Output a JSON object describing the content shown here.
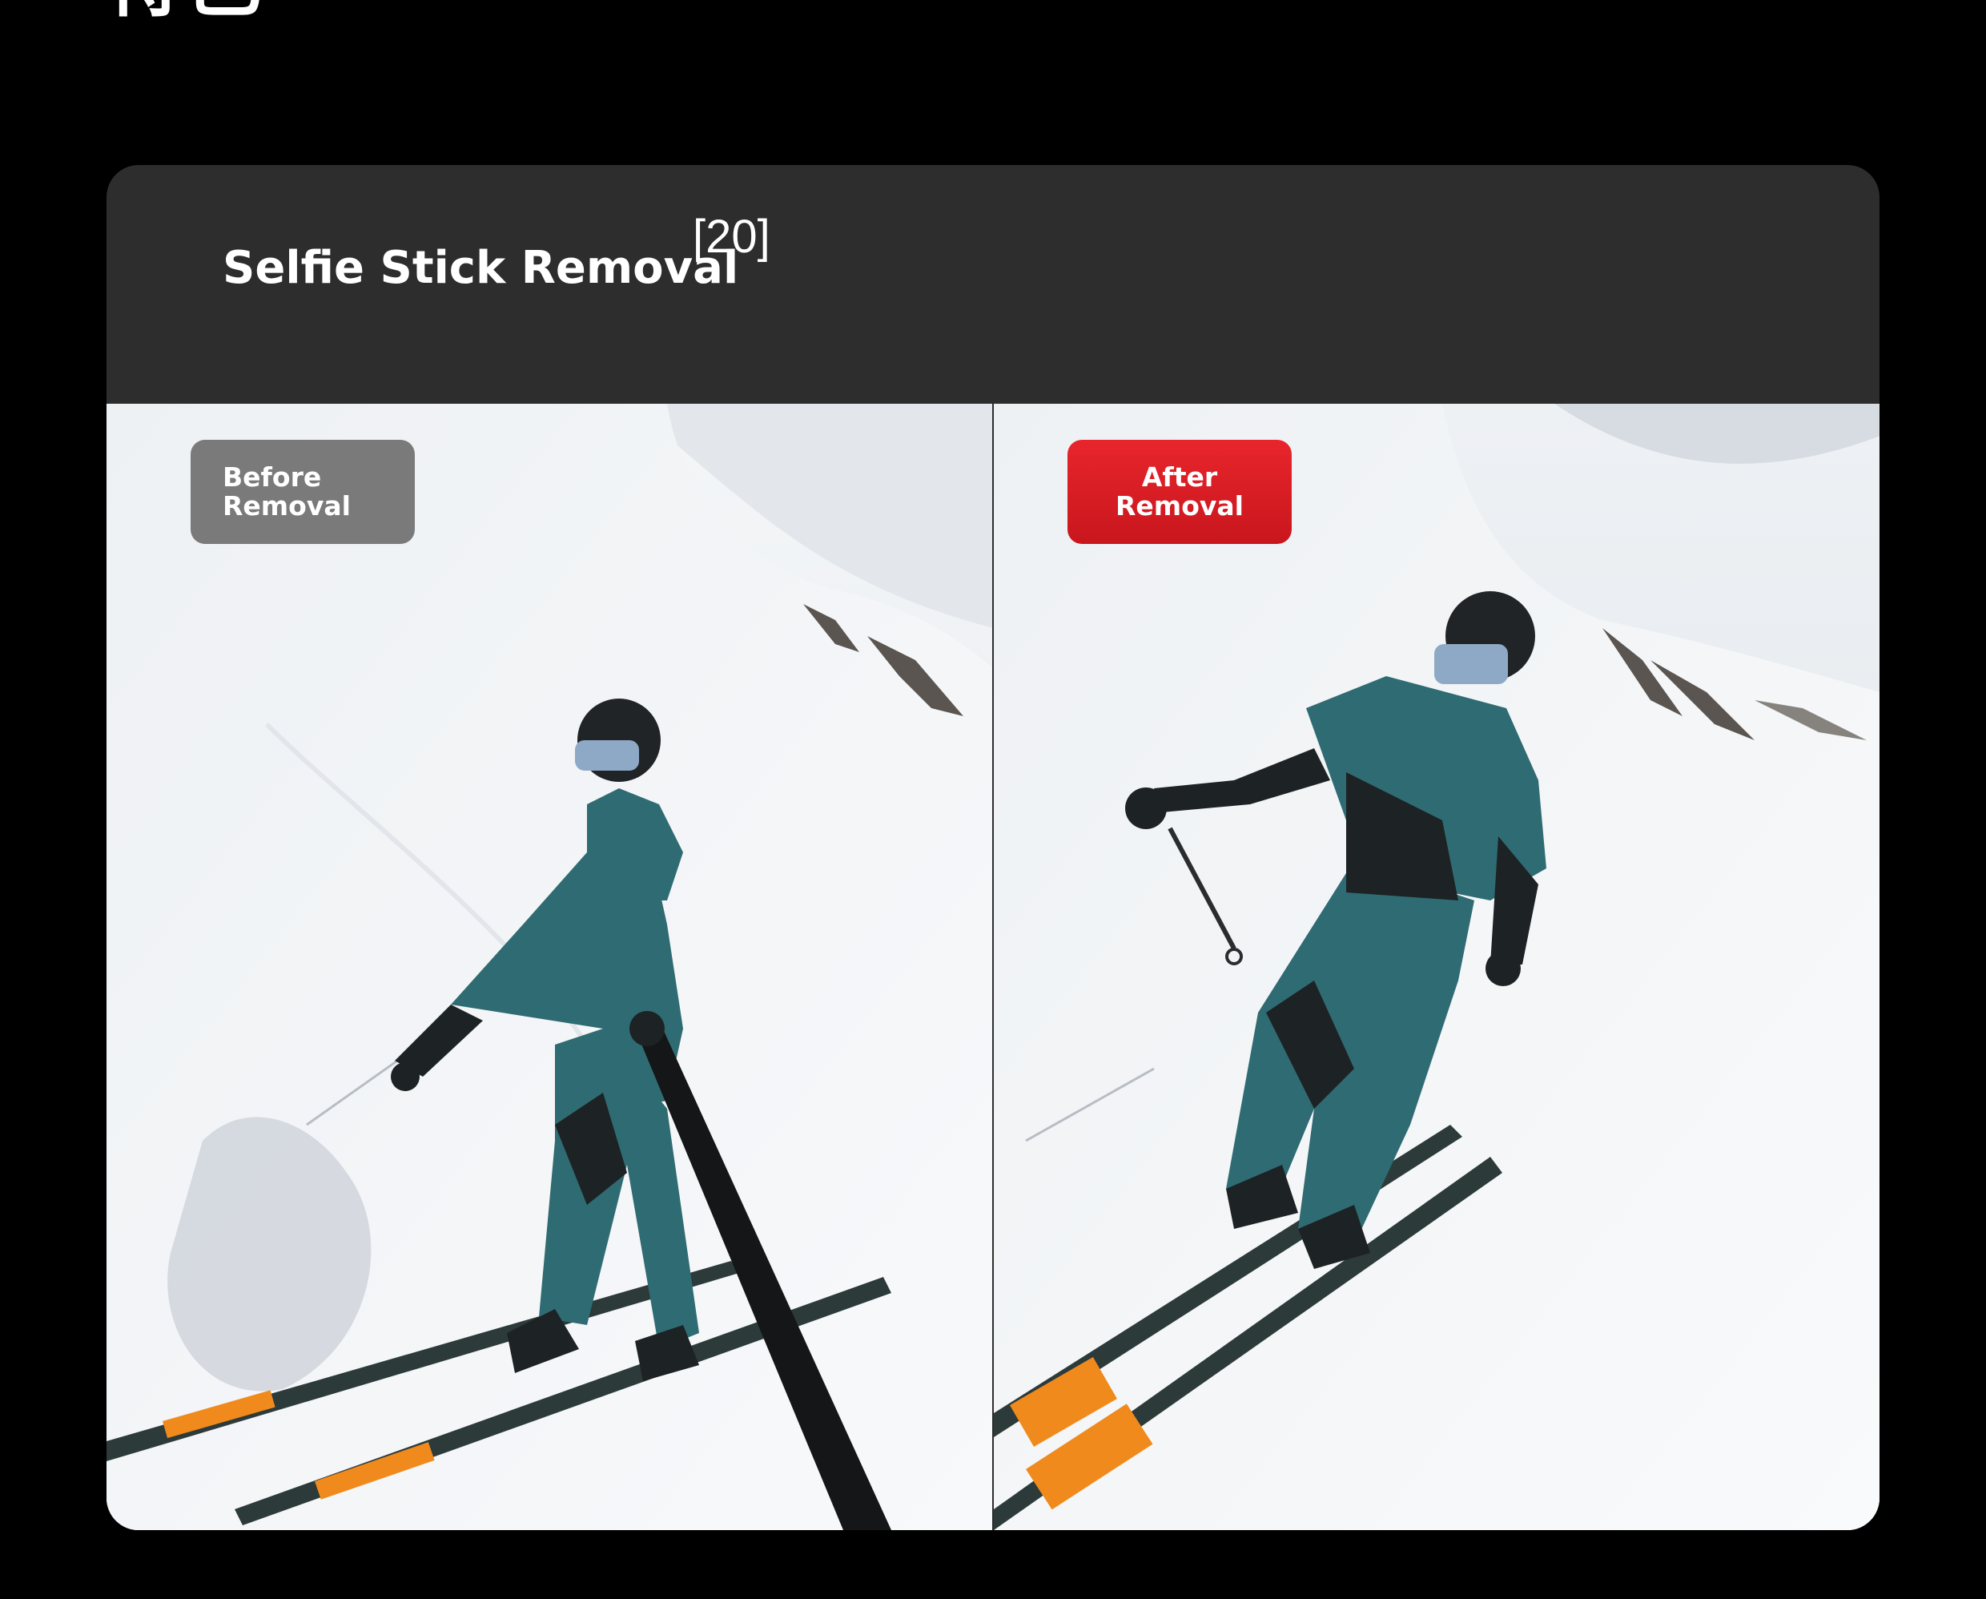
{
  "header_fragment": "特色",
  "card": {
    "title": "Selfie Stick Removal",
    "reference": "[20]"
  },
  "panels": {
    "before": {
      "line1": "Before",
      "line2": "Removal"
    },
    "after": {
      "line1": "After",
      "line2": "Removal"
    }
  },
  "colors": {
    "background": "#000000",
    "card": "#2d2d2d",
    "before_badge": "#7a7a7a",
    "after_badge": "#e01f26"
  }
}
